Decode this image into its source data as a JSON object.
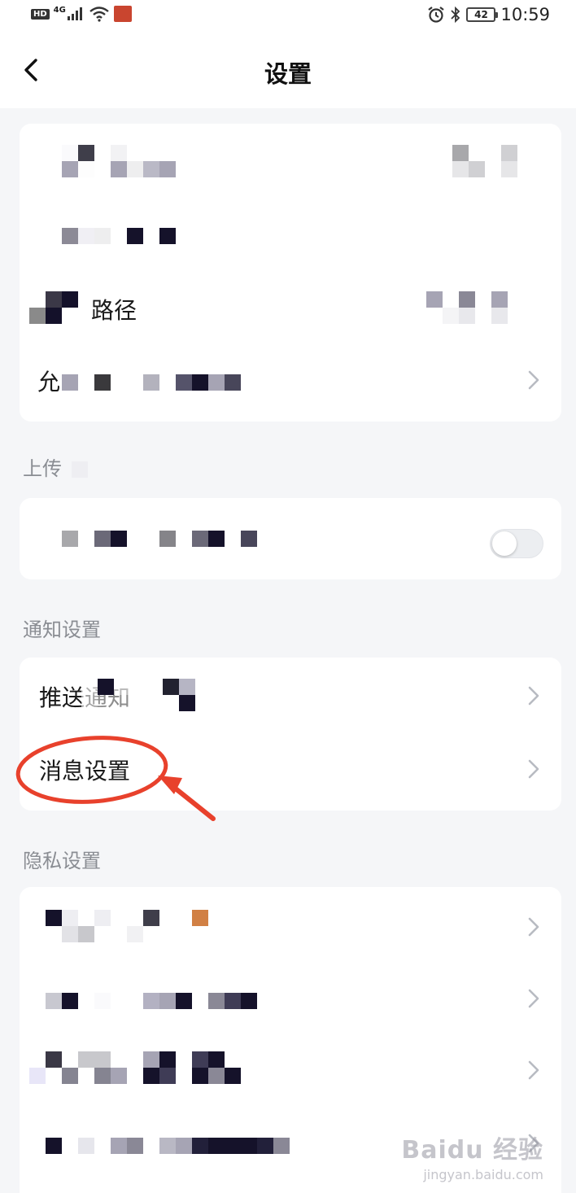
{
  "status_bar": {
    "hd": "HD",
    "network": "4G",
    "battery": "42",
    "time": "10:59"
  },
  "nav": {
    "title": "设置"
  },
  "card1": {
    "row3_label_tail": "路径",
    "row4_label_head": "允"
  },
  "sections": {
    "upload_title": "上传",
    "notify_title": "通知设置",
    "privacy_title": "隐私设置"
  },
  "notify": {
    "push_label": "推送通知",
    "message_label": "消息设置"
  },
  "watermark": {
    "main": "Baidu 经验",
    "sub": "jingyan.baidu.com"
  },
  "colors": {
    "background": "#f5f6f8",
    "card": "#ffffff",
    "annotation": "#e8412c",
    "section_text": "#8a8d93"
  }
}
